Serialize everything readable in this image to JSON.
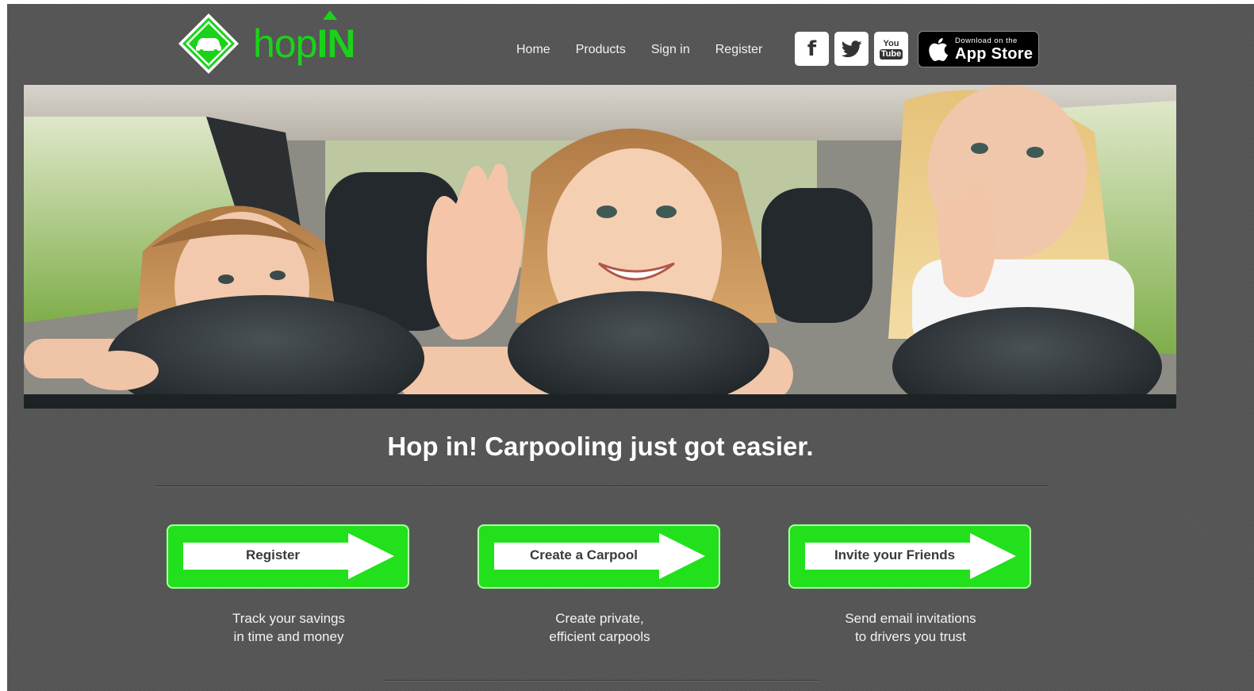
{
  "brand": {
    "name_light": "hop",
    "name_bold": "IN",
    "color": "#1bd21b"
  },
  "nav": [
    {
      "label": "Home"
    },
    {
      "label": "Products"
    },
    {
      "label": "Sign in"
    },
    {
      "label": "Register"
    }
  ],
  "social": [
    {
      "icon": "facebook-icon",
      "glyph": "f"
    },
    {
      "icon": "twitter-icon",
      "glyph": ""
    },
    {
      "icon": "youtube-icon",
      "line1": "You",
      "line2": "Tube"
    }
  ],
  "app_store": {
    "small": "Download on the",
    "big": "App Store"
  },
  "hero": {
    "alt_subject": "children-in-car-photo"
  },
  "tagline": "Hop in! Carpooling just got easier.",
  "ctas": [
    {
      "label": "Register",
      "desc_line1": "Track your savings",
      "desc_line2": "in time and money"
    },
    {
      "label": "Create a Carpool",
      "desc_line1": "Create private,",
      "desc_line2": "efficient carpools"
    },
    {
      "label": "Invite your Friends",
      "desc_line1": "Send email invitations",
      "desc_line2": "to drivers you trust"
    }
  ],
  "colors": {
    "background": "#555555",
    "accent_green": "#22e01b"
  }
}
